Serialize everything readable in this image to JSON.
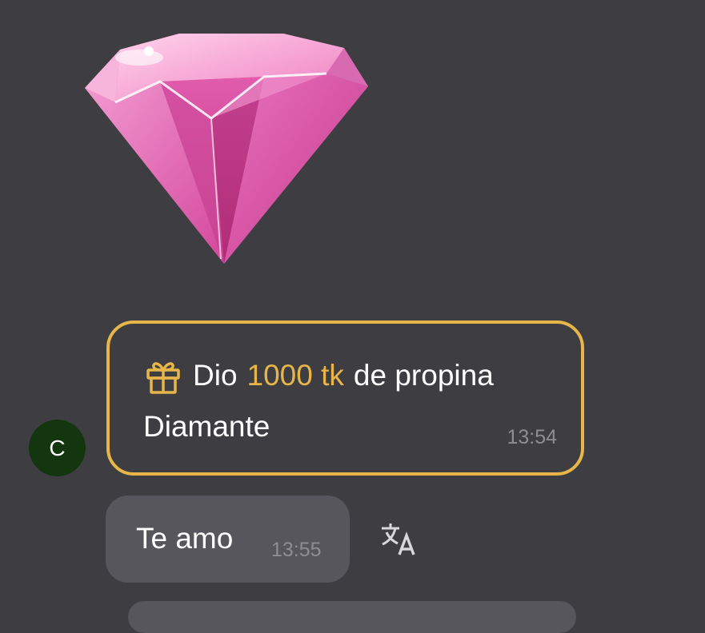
{
  "messages": {
    "sender_initial": "C",
    "gift": {
      "sticker": "pink-diamond-sticker",
      "icon": "gift-icon",
      "prefix": "Dio",
      "amount": "1000 tk",
      "suffix": "de propina",
      "name": "Diamante",
      "time": "13:54",
      "accent_color": "#e7b54a"
    },
    "text": {
      "body": "Te amo",
      "time": "13:55"
    },
    "translate_icon": "translate-icon"
  }
}
